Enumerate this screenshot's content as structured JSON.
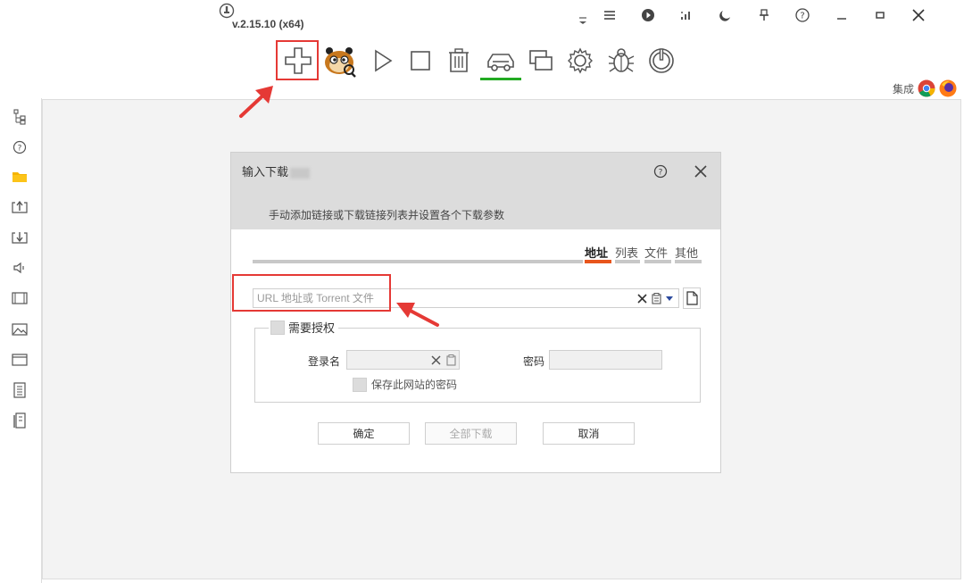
{
  "app": {
    "version": "v.2.15.10 (x64)"
  },
  "window_controls": [
    "menu-collapse",
    "menu",
    "play",
    "speed",
    "night-mode",
    "pin",
    "help",
    "minimize",
    "maximize",
    "close"
  ],
  "toolbar": {
    "buttons": [
      "add-task",
      "mascot",
      "start",
      "stop",
      "delete",
      "car-mode",
      "windows",
      "settings",
      "bug",
      "power"
    ],
    "active": "car-mode"
  },
  "integration": {
    "label": "集成",
    "browsers": [
      "chrome",
      "firefox"
    ]
  },
  "sidebar": {
    "items": [
      "tree",
      "help",
      "folder",
      "upload",
      "download",
      "audio",
      "video",
      "image",
      "window",
      "document",
      "archive"
    ]
  },
  "dialog": {
    "title": "输入下载",
    "description": "手动添加链接或下载链接列表并设置各个下载参数",
    "tabs": [
      {
        "label": "地址",
        "active": true
      },
      {
        "label": "列表",
        "active": false
      },
      {
        "label": "文件",
        "active": false
      },
      {
        "label": "其他",
        "active": false
      }
    ],
    "url": {
      "placeholder": "URL 地址或 Torrent 文件",
      "value": ""
    },
    "auth": {
      "title": "需要授权",
      "checked": false,
      "username_label": "登录名",
      "username_value": "",
      "password_label": "密码",
      "password_value": "",
      "remember_label": "保存此网站的密码"
    },
    "buttons": {
      "ok": "确定",
      "download_all": "全部下载",
      "cancel": "取消"
    }
  },
  "colors": {
    "active_tab": "#e8551c",
    "highlight": "#e53935",
    "active_underline": "#22aa22"
  }
}
